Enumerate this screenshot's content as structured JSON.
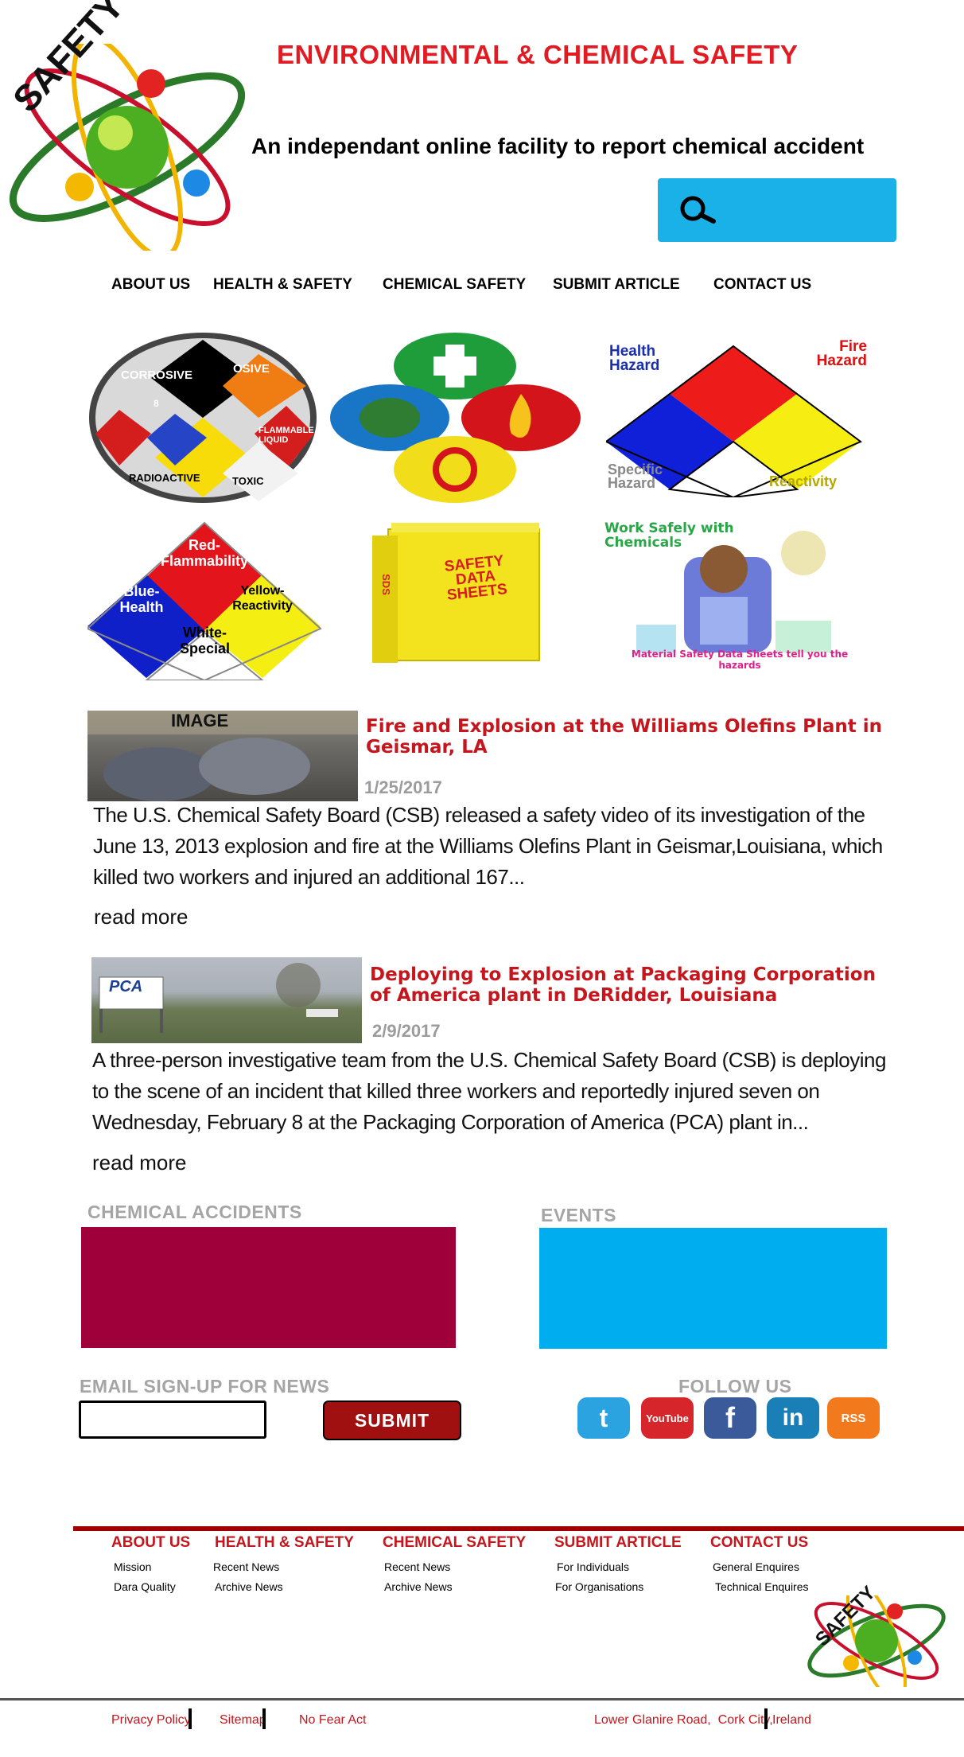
{
  "header": {
    "logo_text": "SAFETY",
    "title": "ENVIRONMENTAL & CHEMICAL SAFETY",
    "tagline": "An independant online facility to report chemical accident"
  },
  "search": {
    "icon": "search-icon",
    "value": ""
  },
  "nav": [
    "ABOUT US",
    "HEALTH & SAFETY",
    "CHEMICAL SAFETY",
    "SUBMIT ARTICLE",
    "CONTACT US"
  ],
  "tiles": {
    "hazard_wheel": [
      "CORROSIVE",
      "OSIVE",
      "FLAMMABLE LIQUID",
      "RADIOACTIVE",
      "TOXIC",
      "8"
    ],
    "nfpa_diamond": {
      "health": "Health Hazard",
      "fire": "Fire Hazard",
      "specific": "Specific Hazard",
      "reactivity": "Reactivity"
    },
    "nfpa_colors": {
      "red": "Red-Flammability",
      "blue": "Blue-Health",
      "yellow": "Yellow-Reactivity",
      "white": "White-Special"
    },
    "sds_binder": {
      "title": "SAFETY DATA SHEETS",
      "spine": "SDS"
    },
    "work_safely": {
      "title": "Work Safely with Chemicals",
      "caption": "Material Safety Data Sheets tell you the hazards"
    }
  },
  "articles": [
    {
      "image_label": "IMAGE",
      "title": "Fire and Explosion at the Williams Olefins Plant in Geismar, LA",
      "date": "1/25/2017",
      "body": "The U.S. Chemical Safety Board (CSB) released a safety video of its investigation of the June 13, 2013 explosion and fire at the Williams Olefins Plant in Geismar,Louisiana, which killed two workers and injured an additional 167...",
      "read_more": "read more"
    },
    {
      "image_label": "PCA",
      "title": "Deploying to Explosion at Packaging Corporation of America plant in DeRidder, Louisiana",
      "date": "2/9/2017",
      "body": "A three-person investigative team from the U.S. Chemical Safety Board (CSB) is deploying to the scene of an incident that killed three workers and reportedly injured seven on Wednesday, February 8 at the Packaging Corporation of America (PCA) plant in...",
      "read_more": "read more"
    }
  ],
  "sections": {
    "accidents": "CHEMICAL ACCIDENTS",
    "events": "EVENTS"
  },
  "signup": {
    "heading": "EMAIL SIGN-UP FOR NEWS",
    "value": "",
    "submit": "SUBMIT"
  },
  "follow": {
    "heading": "FOLLOW US",
    "icons": [
      {
        "name": "twitter-icon",
        "glyph": "t",
        "color": "#2aa3e0"
      },
      {
        "name": "youtube-icon",
        "glyph": "YouTube",
        "color": "#d7262b"
      },
      {
        "name": "facebook-icon",
        "glyph": "f",
        "color": "#3b5a9a"
      },
      {
        "name": "linkedin-icon",
        "glyph": "in",
        "color": "#1a7fb6"
      },
      {
        "name": "rss-icon",
        "glyph": "RSS",
        "color": "#f27a1c"
      }
    ]
  },
  "footer": {
    "columns": [
      {
        "title": "ABOUT US",
        "links": [
          "Mission",
          "Dara Quality"
        ]
      },
      {
        "title": "HEALTH & SAFETY",
        "links": [
          "Recent News",
          "Archive News"
        ]
      },
      {
        "title": "CHEMICAL SAFETY",
        "links": [
          "Recent News",
          "Archive News"
        ]
      },
      {
        "title": "SUBMIT ARTICLE",
        "links": [
          "For Individuals",
          "For Organisations"
        ]
      },
      {
        "title": "CONTACT US",
        "links": [
          "General Enquires",
          "Technical Enquires"
        ]
      }
    ],
    "bottom_links": [
      "Privacy Policy",
      "Sitemap",
      "No Fear Act"
    ],
    "address": [
      "Lower Glanire Road,  Cork City,",
      "Ireland"
    ]
  },
  "colors": {
    "accent": "#c4161c",
    "title_red": "#e21b23",
    "cyan": "#1ab1e9",
    "maroon": "#a0003a"
  }
}
